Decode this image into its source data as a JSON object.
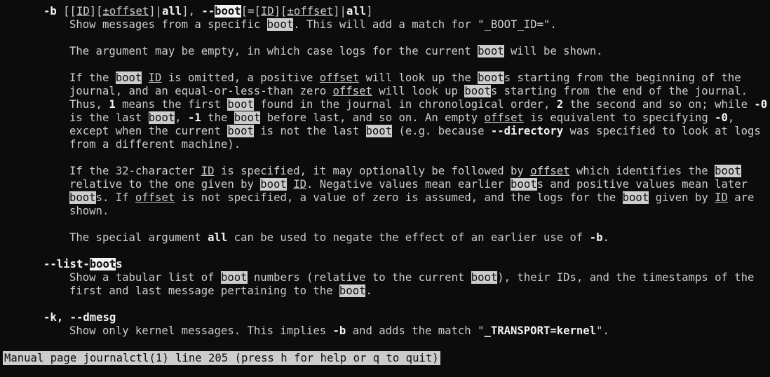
{
  "manpage": {
    "option_b": {
      "dash": "-b",
      "syntax_parts": [
        "[[",
        "ID",
        "][",
        "±offset",
        "]|",
        "all",
        "], --",
        "boot",
        "[=[",
        "ID",
        "][",
        "±offset",
        "]|",
        "all",
        "]"
      ],
      "paragraphs": [
        [
          "Show messages from a specific boot. This will add a match for \"_BOOT_ID=\"."
        ],
        [
          "The argument may be empty, in which case logs for the current boot will be shown."
        ],
        [
          "If the boot ID is omitted, a positive offset will look up the boots starting from the beginning of the",
          "journal, and an equal-or-less-than zero offset will look up boots starting from the end of the journal.",
          "Thus, 1 means the first boot found in the journal in chronological order, 2 the second and so on; while -0",
          "is the last boot, -1 the boot before last, and so on. An empty offset is equivalent to specifying -0,",
          "except when the current boot is not the last boot (e.g. because --directory was specified to look at logs",
          "from a different machine)."
        ],
        [
          "If the 32-character ID is specified, it may optionally be followed by offset which identifies the boot",
          "relative to the one given by boot ID. Negative values mean earlier boots and positive values mean later",
          "boots. If offset is not specified, a value of zero is assumed, and the logs for the boot given by ID are",
          "shown."
        ],
        [
          "The special argument all can be used to negate the effect of an earlier use of -b."
        ]
      ]
    },
    "option_list_boots": {
      "name": "--list-boots",
      "description": [
        "Show a tabular list of boot numbers (relative to the current boot), their IDs, and the timestamps of the",
        "first and last message pertaining to the boot."
      ]
    },
    "option_k": {
      "name": "-k, --dmesg",
      "description": [
        "Show only kernel messages. This implies -b and adds the match \"_TRANSPORT=kernel\"."
      ]
    }
  },
  "status_bar": {
    "text": "Manual page journalctl(1) line 205 (press h for help or q to quit)"
  },
  "search_term": "boot",
  "colors": {
    "background": "#0c0c0c",
    "foreground": "#cccccc",
    "bold": "#f2f2f2",
    "highlight_bg": "#cccccc"
  }
}
